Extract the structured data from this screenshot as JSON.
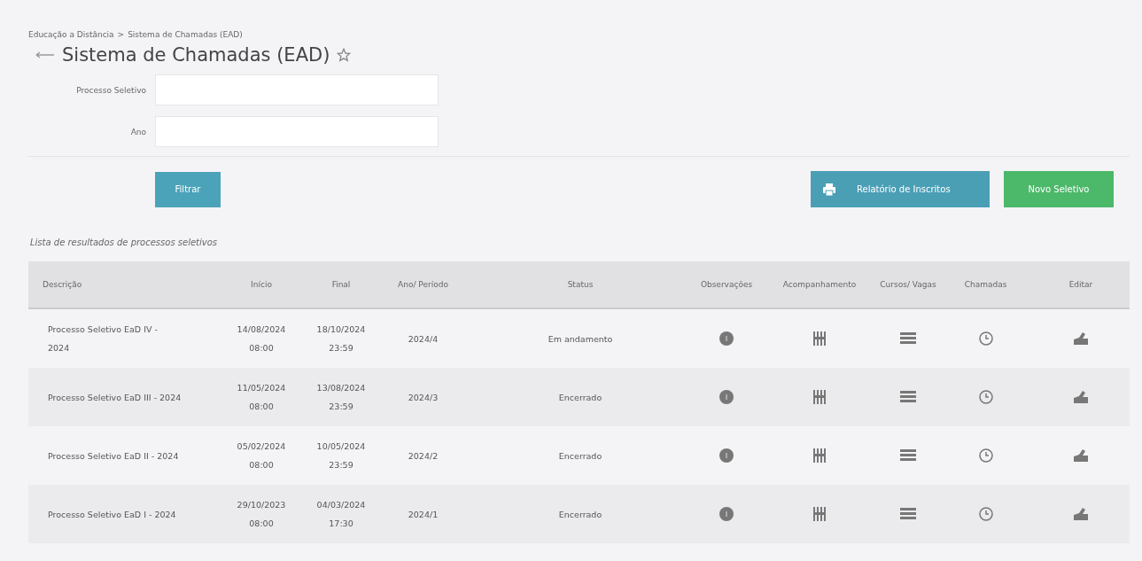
{
  "breadcrumb": [
    "Educação a Distância",
    "Sistema de Chamadas (EAD)"
  ],
  "breadcrumb_separator": ">",
  "title": "Sistema de Chamadas (EAD)",
  "filters": [
    {
      "label": "Processo Seletivo"
    },
    {
      "label": "Ano"
    }
  ],
  "filter_button": "Filtrar",
  "report_button": "Relatório de Inscritos",
  "new_button": "Novo Seletivo",
  "caption": "Lista de resultados de processos seletivos",
  "columns": [
    "Descrição",
    "Início",
    "Final",
    "Ano/ Período",
    "Status",
    "Observações",
    "Acompanhamento",
    "Cursos/ Vagas",
    "Chamadas",
    "Editar"
  ],
  "rows": [
    {
      "description": "Processo Seletivo EaD IV - 2024",
      "start": [
        "14/08/2024",
        "08:00"
      ],
      "end": [
        "18/10/2024",
        "23:59"
      ],
      "period": "2024/4",
      "status": "Em andamento"
    },
    {
      "description": "Processo Seletivo EaD III - 2024",
      "start": [
        "11/05/2024",
        "08:00"
      ],
      "end": [
        "13/08/2024",
        "23:59"
      ],
      "period": "2024/3",
      "status": "Encerrado"
    },
    {
      "description": "Processo Seletivo EaD II - 2024",
      "start": [
        "05/02/2024",
        "08:00"
      ],
      "end": [
        "10/05/2024",
        "23:59"
      ],
      "period": "2024/2",
      "status": "Encerrado"
    },
    {
      "description": "Processo Seletivo EaD I - 2024",
      "start": [
        "29/10/2023",
        "08:00"
      ],
      "end": [
        "04/03/2024",
        "17:30"
      ],
      "period": "2024/1",
      "status": "Encerrado"
    }
  ]
}
